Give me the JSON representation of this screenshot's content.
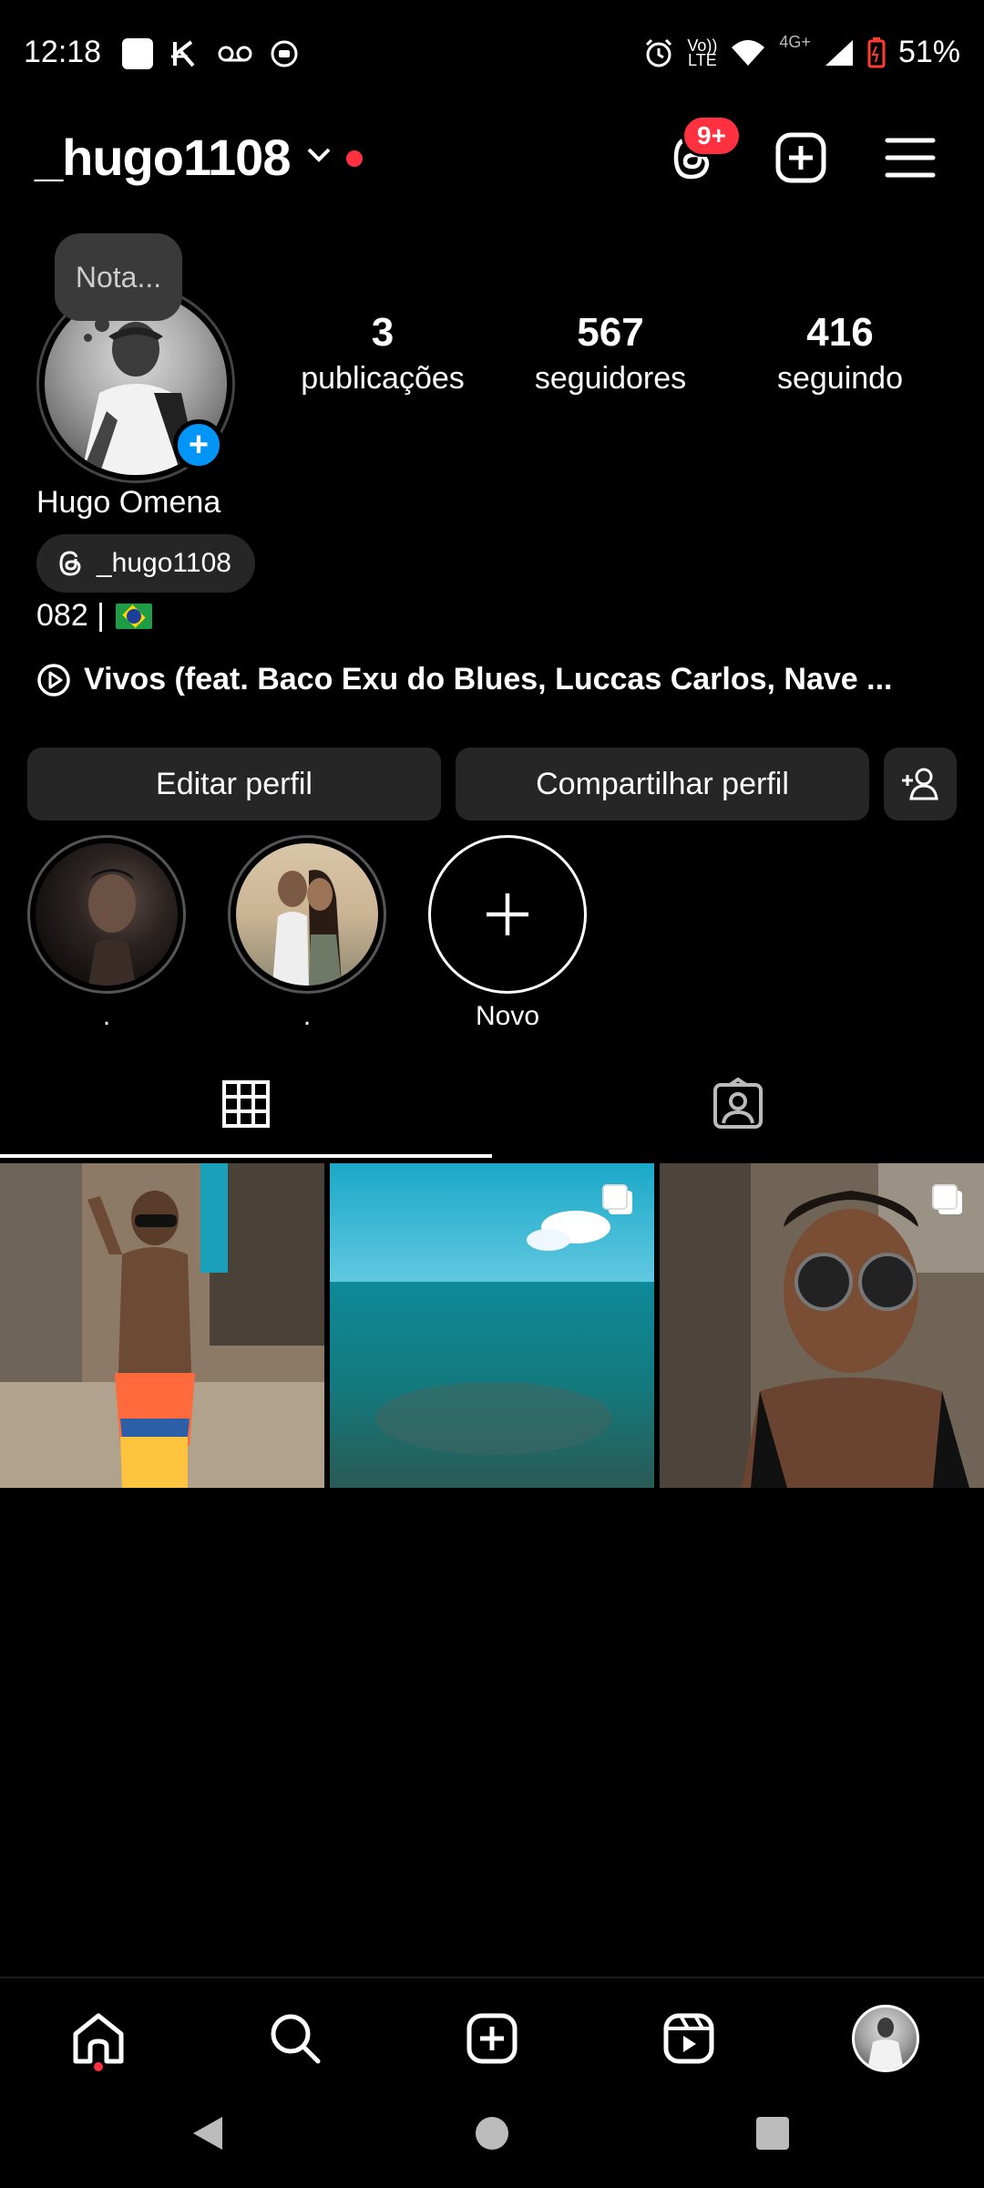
{
  "status_bar": {
    "time": "12:18",
    "net_small_top": "Vo))",
    "net_small_bottom": "LTE",
    "net_4g": "4G+",
    "battery": "51%"
  },
  "header": {
    "username": "_hugo1108",
    "threads_badge": "9+"
  },
  "profile": {
    "note_placeholder": "Nota...",
    "full_name": "Hugo Omena",
    "threads_handle": "_hugo1108",
    "bio": "082 |",
    "music": "Vivos (feat. Baco Exu do Blues, Luccas Carlos, Nave ...",
    "stats": [
      {
        "value": "3",
        "label": "publicações"
      },
      {
        "value": "567",
        "label": "seguidores"
      },
      {
        "value": "416",
        "label": "seguindo"
      }
    ]
  },
  "actions": {
    "edit": "Editar perfil",
    "share": "Compartilhar perfil"
  },
  "highlights": [
    {
      "label": "."
    },
    {
      "label": "."
    },
    {
      "label": "Novo"
    }
  ],
  "colors": {
    "accent": "#0095f6",
    "notification": "#ff3040",
    "button_bg": "#262626"
  }
}
